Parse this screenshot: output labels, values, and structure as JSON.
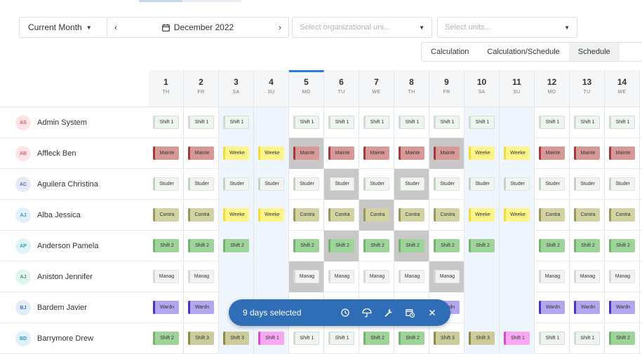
{
  "toolbar": {
    "period": "Current Month",
    "date": "December 2022",
    "org_placeholder": "Select organizational uni...",
    "units_placeholder": "Select units..."
  },
  "modes": [
    {
      "label": "Calculation",
      "active": false
    },
    {
      "label": "Calculation/Schedule",
      "active": false
    },
    {
      "label": "Schedule",
      "active": true
    }
  ],
  "days": [
    {
      "num": "1",
      "dow": "TH"
    },
    {
      "num": "2",
      "dow": "FR"
    },
    {
      "num": "3",
      "dow": "SA"
    },
    {
      "num": "4",
      "dow": "SU"
    },
    {
      "num": "5",
      "dow": "MO"
    },
    {
      "num": "6",
      "dow": "TU"
    },
    {
      "num": "7",
      "dow": "WE"
    },
    {
      "num": "8",
      "dow": "TH"
    },
    {
      "num": "9",
      "dow": "FR"
    },
    {
      "num": "10",
      "dow": "SA"
    },
    {
      "num": "11",
      "dow": "SU"
    },
    {
      "num": "12",
      "dow": "MO"
    },
    {
      "num": "13",
      "dow": "TU"
    },
    {
      "num": "14",
      "dow": "WE"
    }
  ],
  "employees": [
    {
      "initials": "AS",
      "name": "Admin System",
      "avatar_bg": "#fde4e6",
      "avatar_fg": "#e25b6a"
    },
    {
      "initials": "AB",
      "name": "Affleck Ben",
      "avatar_bg": "#fde4e6",
      "avatar_fg": "#e25b6a"
    },
    {
      "initials": "AC",
      "name": "Aguilera Christina",
      "avatar_bg": "#e6eaf6",
      "avatar_fg": "#5b6fb5"
    },
    {
      "initials": "AJ",
      "name": "Alba Jessica",
      "avatar_bg": "#e2f0fa",
      "avatar_fg": "#3d8ec9"
    },
    {
      "initials": "AP",
      "name": "Anderson Pamela",
      "avatar_bg": "#e0f4f6",
      "avatar_fg": "#2ea3b0"
    },
    {
      "initials": "AJ",
      "name": "Aniston Jennifer",
      "avatar_bg": "#e3f3ee",
      "avatar_fg": "#3b9c7c"
    },
    {
      "initials": "BJ",
      "name": "Bardem Javier",
      "avatar_bg": "#e2ecfa",
      "avatar_fg": "#3d72c9"
    },
    {
      "initials": "BD",
      "name": "Barrymore Drew",
      "avatar_bg": "#e0f1f8",
      "avatar_fg": "#2e93b8"
    }
  ],
  "shifts": {
    "s1": "Shift 1",
    "s2": "Shift 2",
    "s3": "Shift 3",
    "mt": "Mainte",
    "wk": "Weeke",
    "st": "Studer",
    "ct": "Contra",
    "mg": "Manag",
    "wd": "Wardn",
    "pk": "Shift 1"
  },
  "schedule": [
    [
      "s1",
      "s1",
      "s1",
      "",
      "s1",
      "s1",
      "s1",
      "s1",
      "s1",
      "s1",
      "",
      "s1",
      "s1",
      "s1"
    ],
    [
      "mt",
      "mt",
      "wk",
      "wk",
      "mt",
      "mt",
      "mt",
      "mt",
      "mt",
      "wk",
      "wk",
      "mt",
      "mt",
      "mt"
    ],
    [
      "st",
      "st",
      "st",
      "st",
      "st",
      "st",
      "st",
      "st",
      "st",
      "st",
      "st",
      "st",
      "st",
      "st"
    ],
    [
      "ct",
      "ct",
      "wk",
      "wk",
      "ct",
      "ct",
      "ct",
      "ct",
      "ct",
      "wk",
      "wk",
      "ct",
      "ct",
      "ct"
    ],
    [
      "s2",
      "s2",
      "s2",
      "",
      "s2",
      "s2",
      "s2",
      "s2",
      "s2",
      "s2",
      "",
      "s2",
      "s2",
      "s2"
    ],
    [
      "mg",
      "mg",
      "",
      "",
      "mg",
      "mg",
      "mg",
      "mg",
      "mg",
      "",
      "",
      "mg",
      "mg",
      "mg"
    ],
    [
      "wd",
      "wd",
      "",
      "",
      "",
      "",
      "",
      "",
      "wd",
      "",
      "",
      "wd",
      "wd",
      "wd"
    ],
    [
      "s2",
      "s3",
      "s3",
      "pk",
      "s1",
      "s1",
      "s2",
      "s2",
      "s3",
      "s3",
      "pk",
      "s1",
      "s1",
      "s2"
    ]
  ],
  "selected": [
    [],
    [
      4,
      8
    ],
    [
      5,
      7
    ],
    [
      6
    ],
    [
      5,
      7
    ],
    [
      4,
      8
    ],
    [],
    []
  ],
  "selection_bar": {
    "text": "9 days selected",
    "actions": [
      "clock-icon",
      "umbrella-icon",
      "wrench-icon",
      "calendar-clock-icon",
      "close-icon"
    ]
  },
  "colors": {
    "accent": "#2b7be4",
    "selection_bar": "#2f6db7",
    "weekend_bg": "#eef5fd",
    "selected_bg": "#c8c8c8"
  }
}
